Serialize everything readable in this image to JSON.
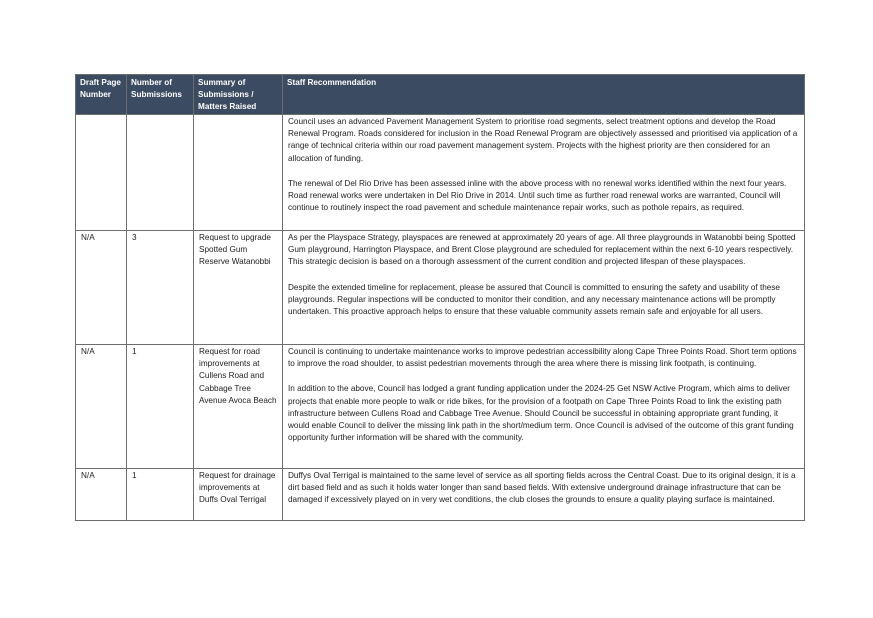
{
  "headers": {
    "page": "Draft Page Number",
    "count": "Number of Submissions",
    "summary": "Summary of Submissions / Matters Raised",
    "recommendation": "Staff Recommendation"
  },
  "rows": [
    {
      "page": "",
      "count": "",
      "summary": "",
      "recommendation": [
        "Council uses an advanced Pavement Management System to prioritise road segments, select treatment options and develop the Road Renewal Program. Roads considered for inclusion in the Road Renewal Program are objectively assessed and prioritised via application of a range of technical criteria within our road pavement management system. Projects with the highest priority are then considered for an allocation of funding.",
        "The renewal of Del Rio Drive has been assessed inline with the above process with no renewal works identified within the next four years. Road renewal works were undertaken in Del Rio Drive in 2014. Until such time as further road renewal works are warranted, Council will continue to routinely inspect the road pavement and schedule maintenance repair works, such as pothole repairs, as required."
      ]
    },
    {
      "page": "N/A",
      "count": "3",
      "summary": "Request to upgrade Spotted Gum Reserve Watanobbi",
      "recommendation": [
        "As per the Playspace Strategy, playspaces are renewed at approximately 20 years of age. All three playgrounds in Watanobbi being Spotted Gum playground, Harrington Playspace, and Brent Close playground are scheduled for replacement within the next 6-10 years respectively. This strategic decision is based on a thorough assessment of the current condition and projected lifespan of these playspaces.",
        "Despite the extended timeline for replacement, please be assured that Council is committed to ensuring the safety and usability of these playgrounds. Regular inspections will be conducted to monitor their condition, and any necessary maintenance actions will be promptly undertaken. This proactive approach helps to ensure that these valuable community assets remain safe and enjoyable for all users."
      ]
    },
    {
      "page": "N/A",
      "count": "1",
      "summary": "Request for road improvements at Cullens Road and Cabbage Tree Avenue Avoca Beach",
      "recommendation": [
        "Council is continuing to undertake maintenance works to improve pedestrian accessibility along Cape Three Points Road. Short term options to improve the road shoulder, to assist pedestrian movements through the area where there is missing link footpath, is continuing.",
        "In addition to the above, Council has lodged a grant funding application under the 2024-25 Get NSW Active Program, which aims to deliver projects that enable more people to walk or ride bikes, for the provision of a footpath on Cape Three Points Road to link the existing path infrastructure between Cullens Road and Cabbage Tree Avenue. Should Council be successful in obtaining appropriate grant funding, it would enable Council to deliver the missing link path in the short/medium term. Once Council is advised of the outcome of this grant funding opportunity further information will be shared with the community."
      ]
    },
    {
      "page": "N/A",
      "count": "1",
      "summary": "Request for drainage improvements at Duffs Oval Terrigal",
      "recommendation": [
        "Duffys Oval Terrigal is maintained to the same level of service as all sporting fields across the Central Coast. Due to its original design, it is a dirt based field and as such it holds water longer than sand based fields. With extensive underground drainage infrastructure that can be damaged if excessively played on in very wet conditions, the club closes the grounds to ensure a quality playing surface is maintained."
      ]
    }
  ]
}
